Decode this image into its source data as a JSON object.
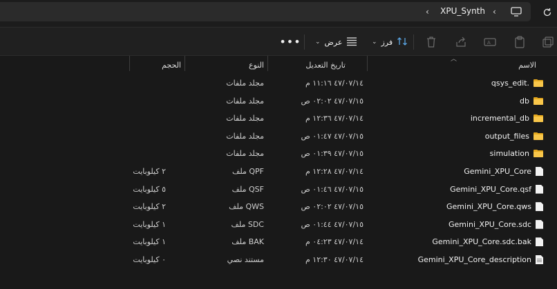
{
  "address": {
    "crumb": "XPU_Synth",
    "chevron": "‹",
    "monitor_icon": "monitor-icon",
    "refresh_icon": "refresh-icon"
  },
  "toolbar": {
    "new_icon": "new-icon",
    "paste_icon": "paste-icon",
    "rename_icon": "rename-icon",
    "share_icon": "share-icon",
    "delete_icon": "trash-icon",
    "sort_label": "فرز",
    "view_label": "عرض",
    "more_label": "•••"
  },
  "columns": {
    "name": "الاسم",
    "date": "تاريخ التعديل",
    "type": "النوع",
    "size": "الحجم"
  },
  "files": [
    {
      "name": "qsys_edit.",
      "date": "٤٧/٠٧/١٤ ١١:١٦ م",
      "type": "مجلد ملفات",
      "size": "",
      "icon": "folder-icon"
    },
    {
      "name": "db",
      "date": "٤٧/٠٧/١٥ ٠٢:٠٢ ص",
      "type": "مجلد ملفات",
      "size": "",
      "icon": "folder-icon"
    },
    {
      "name": "incremental_db",
      "date": "٤٧/٠٧/١٤ ١٢:٣٦ م",
      "type": "مجلد ملفات",
      "size": "",
      "icon": "folder-icon"
    },
    {
      "name": "output_files",
      "date": "٤٧/٠٧/١٥ ٠١:٤٧ ص",
      "type": "مجلد ملفات",
      "size": "",
      "icon": "folder-icon"
    },
    {
      "name": "simulation",
      "date": "٤٧/٠٧/١٥ ٠١:٣٩ ص",
      "type": "مجلد ملفات",
      "size": "",
      "icon": "folder-icon"
    },
    {
      "name": "Gemini_XPU_Core",
      "date": "٤٧/٠٧/١٤ ١٢:٢٨ م",
      "type": "ملف QPF",
      "size": "٢ كيلوبايت",
      "icon": "file-icon"
    },
    {
      "name": "Gemini_XPU_Core.qsf",
      "date": "٤٧/٠٧/١٥ ٠١:٤٦ ص",
      "type": "ملف QSF",
      "size": "٥ كيلوبايت",
      "icon": "file-icon"
    },
    {
      "name": "Gemini_XPU_Core.qws",
      "date": "٤٧/٠٧/١٥ ٠٢:٠٢ ص",
      "type": "ملف QWS",
      "size": "٢ كيلوبايت",
      "icon": "file-icon"
    },
    {
      "name": "Gemini_XPU_Core.sdc",
      "date": "٤٧/٠٧/١٥ ٠١:٤٤ ص",
      "type": "ملف SDC",
      "size": "١ كيلوبايت",
      "icon": "file-icon"
    },
    {
      "name": "Gemini_XPU_Core.sdc.bak",
      "date": "٤٧/٠٧/١٤ ٠٤:٢٣ م",
      "type": "ملف BAK",
      "size": "١ كيلوبايت",
      "icon": "file-icon"
    },
    {
      "name": "Gemini_XPU_Core_description",
      "date": "٤٧/٠٧/١٤ ١٢:٣٠ م",
      "type": "مستند نصي",
      "size": "٠ كيلوبايت",
      "icon": "text-file-icon"
    }
  ]
}
